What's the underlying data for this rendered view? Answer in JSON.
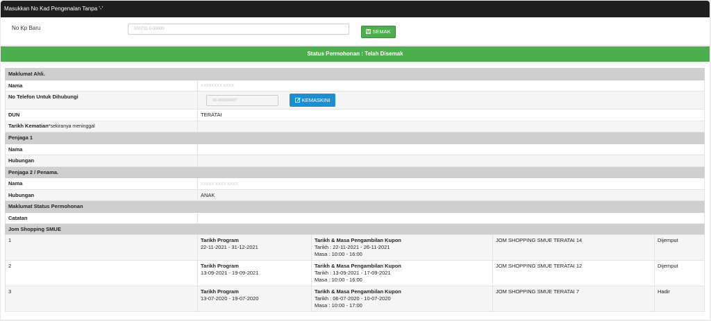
{
  "header": {
    "title": "Masukkan No Kad Pengenalan Tanpa '-'"
  },
  "search": {
    "label": "No Kp Baru",
    "value": "000711-0-00000",
    "button_label": "SEMAK"
  },
  "status": {
    "text": "Status Permohonan : Telah Disemak"
  },
  "info": {
    "section_ahli": "Maklumat Ahli.",
    "nama_label": "Nama",
    "nama_value": "XXXXXXXX XXXX",
    "phone_label": "No Telefon Untuk Dihubungi",
    "phone_value": "00-000000007",
    "update_button": "KEMASKINI",
    "dun_label": "DUN",
    "dun_value": "TERATAI",
    "kematian_label": "Tarikh Kematian",
    "kematian_note": "*sekiranya meninggal",
    "section_penjaga1": "Penjaga 1",
    "p1_nama_label": "Nama",
    "p1_hubungan_label": "Hubungan",
    "section_penjaga2": "Penjaga 2 / Penama.",
    "p2_nama_label": "Nama",
    "p2_nama_value": "XXXXX XXXX XXXX",
    "p2_hubungan_label": "Hubungan",
    "p2_hubungan_value": "ANAK",
    "section_status": "Maklumat Status Permohonan",
    "catatan_label": "Catatan",
    "section_shopping": "Jom Shopping SMUE"
  },
  "shopping": [
    {
      "no": "1",
      "program_title": "Tarikh Program",
      "program_dates": "22-11-2021 - 31-12-2021",
      "kupon_title": "Tarikh & Masa Pengambilan Kupon",
      "kupon_tarikh": "Tarikh : 22-11-2021 - 26-11-2021",
      "kupon_masa": "Masa : 10:00 - 16:00",
      "event": "JOM SHOPPING SMUE TERATAI 14",
      "status": "Dijemput"
    },
    {
      "no": "2",
      "program_title": "Tarikh Program",
      "program_dates": "13-09-2021 - 19-09-2021",
      "kupon_title": "Tarikh & Masa Pengambilan Kupon",
      "kupon_tarikh": "Tarikh : 13-09-2021 - 17-09-2021",
      "kupon_masa": "Masa : 10:00 - 16:00",
      "event": "JOM SHOPPING SMUE TERATAI 12",
      "status": "Dijemput"
    },
    {
      "no": "3",
      "program_title": "Tarikh Program",
      "program_dates": "13-07-2020 - 19-07-2020",
      "kupon_title": "Tarikh & Masa Pengambilan Kupon",
      "kupon_tarikh": "Tarikh : 06-07-2020 - 10-07-2020",
      "kupon_masa": "Masa : 10:00 - 17:00",
      "event": "JOM SHOPPING SMUE TERATAI 7",
      "status": "Hadir"
    }
  ],
  "icons": {
    "save": "floppy-icon",
    "edit": "edit-icon"
  },
  "colors": {
    "topbar": "#1f1f1f",
    "status": "#4cae4c",
    "button_green": "#4cae4c",
    "button_blue": "#1b8fd1",
    "section": "#cfcfcf"
  }
}
